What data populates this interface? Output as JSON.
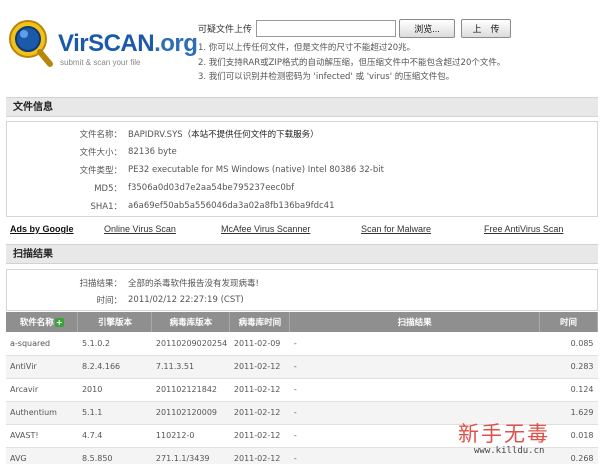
{
  "header": {
    "logo_text_v": "VirSCAN",
    "logo_text_o": ".org",
    "logo_sub": "submit & scan your file",
    "upload_label": "可疑文件上传",
    "browse_label": "浏览...",
    "upload_button": "上　传",
    "notes": [
      "1. 你可以上传任何文件，但是文件的尺寸不能超过20兆。",
      "2. 我们支持RAR或ZIP格式的自动解压缩，但压缩文件中不能包含超过20个文件。",
      "3. 我们可以识别并检测密码为 'infected' 或 'virus' 的压缩文件包。"
    ]
  },
  "file_info": {
    "title": "文件信息",
    "rows": [
      {
        "key": "文件名称：",
        "val": "BAPIDRV.SYS",
        "note": "（本站不提供任何文件的下载服务）"
      },
      {
        "key": "文件大小：",
        "val": "82136 byte",
        "note": ""
      },
      {
        "key": "文件类型：",
        "val": "PE32 executable for MS Windows (native) Intel 80386 32-bit",
        "note": ""
      },
      {
        "key": "MD5：",
        "val": "f3506a0d03d7e2aa54be795237eec0bf",
        "note": ""
      },
      {
        "key": "SHA1：",
        "val": "a6a69ef50ab5a556046da3a02a8fb136ba9fdc41",
        "note": ""
      }
    ]
  },
  "ads": {
    "google": "Ads by Google",
    "links": [
      "Online Virus Scan",
      "McAfee Virus Scanner",
      "Scan for Malware",
      "Free AntiVirus Scan"
    ]
  },
  "scan_result": {
    "title": "扫描结果",
    "summary_key": "扫描结果：",
    "summary_val": "全部的杀毒软件报告没有发现病毒!",
    "time_key": "时间：",
    "time_val": "2011/02/12 22:27:19 (CST)"
  },
  "table": {
    "headers": [
      "软件名称",
      "引擎版本",
      "病毒库版本",
      "病毒库时间",
      "扫描结果",
      "时间"
    ],
    "rows": [
      [
        "a-squared",
        "5.1.0.2",
        "20110209020254",
        "2011-02-09",
        "-",
        "0.085"
      ],
      [
        "AntiVir",
        "8.2.4.166",
        "7.11.3.51",
        "2011-02-12",
        "-",
        "0.283"
      ],
      [
        "Arcavir",
        "2010",
        "201102121842",
        "2011-02-12",
        "-",
        "0.124"
      ],
      [
        "Authentium",
        "5.1.1",
        "201102120009",
        "2011-02-12",
        "-",
        "1.629"
      ],
      [
        "AVAST!",
        "4.7.4",
        "110212-0",
        "2011-02-12",
        "-",
        "0.018"
      ],
      [
        "AVG",
        "8.5.850",
        "271.1.1/3439",
        "2011-02-12",
        "-",
        "0.268"
      ]
    ]
  },
  "watermark": {
    "text": "新手无毒",
    "url": "www.killdu.cn"
  }
}
